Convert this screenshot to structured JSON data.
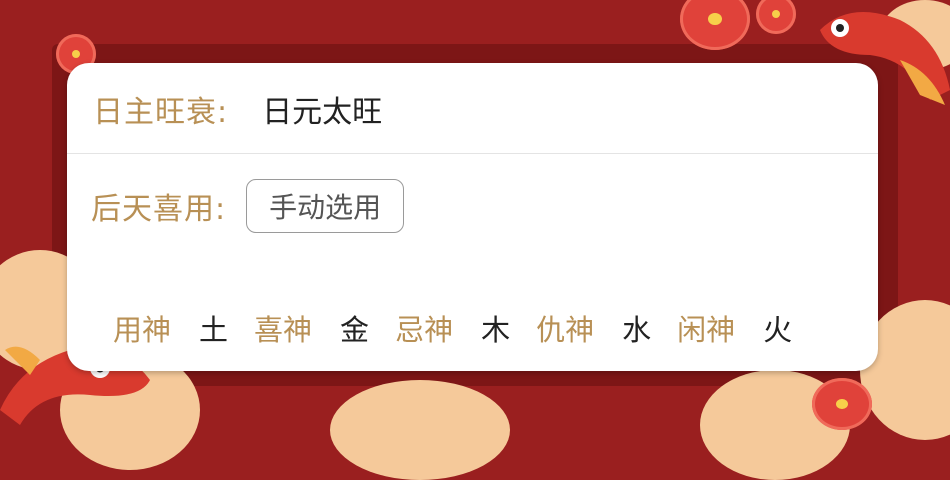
{
  "strength": {
    "label": "日主旺衰:",
    "value": "日元太旺"
  },
  "preference": {
    "label": "后天喜用:",
    "button": "手动选用"
  },
  "gods": [
    {
      "label": "用神",
      "element": "土"
    },
    {
      "label": "喜神",
      "element": "金"
    },
    {
      "label": "忌神",
      "element": "木"
    },
    {
      "label": "仇神",
      "element": "水"
    },
    {
      "label": "闲神",
      "element": "火"
    }
  ],
  "colors": {
    "background": "#9a1f1f",
    "label": "#b89055",
    "value": "#222222"
  }
}
